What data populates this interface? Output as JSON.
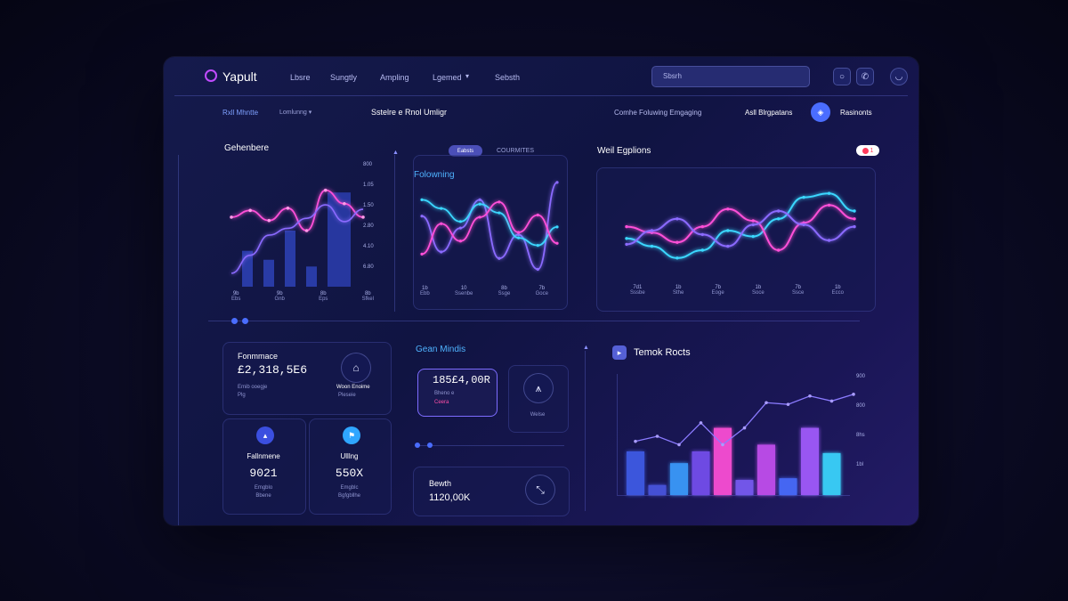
{
  "brand": {
    "name": "Yapult"
  },
  "nav": {
    "items": [
      "Lbsre",
      "Sungtly",
      "Ampling",
      "Lgemed"
    ],
    "dropdown_icon": "chevron-down-icon",
    "last_item": "Sebsth"
  },
  "header": {
    "search_placeholder": "Sbsrh",
    "icons": [
      "circle-icon",
      "phone-icon",
      "profile-icon"
    ]
  },
  "toolbar": {
    "left_link": "Rxll Mhntte",
    "filter": "Lomlunng",
    "center_title": "Sstelre e Rnol Umligr",
    "right_text": "Comhe Foluwing Emgaging",
    "right_link": "Asll Blrgpatans",
    "account_label": "Rasinonts"
  },
  "panel_left": {
    "title": "Gehenbere",
    "y_ticks": [
      "800",
      "1.05",
      "1.50",
      "2.80",
      "4.10",
      "6.80"
    ],
    "x_ticks": [
      "9b",
      "9b",
      "8b",
      "8b"
    ],
    "x_sublabels": [
      "Ebs",
      "Gnb",
      "Eps",
      "Sfkel"
    ]
  },
  "panel_mid": {
    "tab_active": "Eabsts",
    "tab_inactive": "COURMITES",
    "title": "Folowning",
    "x_ticks": [
      "1b",
      "10",
      "8b",
      "7b"
    ],
    "x_sublabels": [
      "Ebb",
      "Ssenbe",
      "Ssge",
      "Goce"
    ]
  },
  "panel_right": {
    "title": "Weil Egplions",
    "badge": "1",
    "x_ticks": [
      "7d1",
      "1b",
      "7b",
      "1b",
      "7b",
      "1b"
    ],
    "x_sublabels": [
      "Sssbe",
      "Sthe",
      "Eoge",
      "Soce",
      "Ssce",
      "Ecco"
    ]
  },
  "stats": {
    "card1": {
      "label": "Fonmmace",
      "value": "£2,318,5E6",
      "sub1": "Emib ooegje",
      "sub2": "Plg",
      "icon_label": "Woon Enoime",
      "icon_sub": "Pleseie"
    },
    "card2": {
      "label": "Fallnmene",
      "value": "9021",
      "sub1": "Emgblo",
      "sub2": "Bbene"
    },
    "card3": {
      "label": "Ulllng",
      "value": "550X",
      "sub1": "Emgblc",
      "sub2": "Bgfgbllhe"
    }
  },
  "metrics": {
    "title": "Gean Mindis",
    "card1": {
      "value": "185£4,00R",
      "sub1": "Bheno e",
      "sub2": "Ceera"
    },
    "card2": {
      "label": "Welse"
    },
    "card3": {
      "label": "Bewth",
      "value": "1120,00K"
    }
  },
  "panel_bar": {
    "title": "Temok Rocts",
    "y_ticks": [
      "900",
      "800",
      "8hs",
      "1bl"
    ]
  },
  "colors": {
    "pink": "#ff4fd8",
    "cyan": "#3ad7ff",
    "purple": "#8b6bff",
    "blue": "#4a6dff"
  },
  "chart_data": [
    {
      "type": "bar",
      "title": "Gehenbere",
      "values": [
        3.2,
        2.4,
        5.0,
        1.8,
        8.4
      ],
      "series_line_pink": [
        6.2,
        6.8,
        5.9,
        7.0,
        5.0,
        8.6,
        7.4,
        6.2
      ],
      "series_line_purple": [
        1.2,
        2.8,
        4.6,
        5.2,
        6.1,
        7.3,
        5.8,
        6.9
      ]
    },
    {
      "type": "line",
      "title": "Folowning",
      "series": [
        {
          "values": [
            6.5,
            3.2,
            5.4,
            8.0,
            2.6,
            4.8,
            1.6,
            9.6
          ]
        },
        {
          "values": [
            8.0,
            7.2,
            6.0,
            7.6,
            6.8,
            4.5,
            3.8,
            5.5
          ]
        },
        {
          "values": [
            3.0,
            5.8,
            4.2,
            6.4,
            7.8,
            5.0,
            6.6,
            4.0
          ]
        }
      ]
    },
    {
      "type": "line",
      "title": "Weil Egplions",
      "series": [
        {
          "values": [
            4.2,
            3.4,
            2.2,
            3.0,
            5.0,
            4.4,
            6.2,
            8.4,
            8.8,
            7.0
          ]
        },
        {
          "values": [
            5.4,
            4.8,
            3.8,
            5.4,
            7.2,
            6.0,
            3.0,
            5.8,
            7.6,
            6.2
          ]
        },
        {
          "values": [
            3.6,
            5.0,
            6.2,
            4.6,
            3.4,
            5.6,
            7.0,
            5.6,
            4.0,
            5.4
          ]
        }
      ]
    },
    {
      "type": "bar",
      "title": "Temok Rocts",
      "values": [
        5.2,
        1.2,
        3.8,
        5.2,
        8.0,
        1.8,
        6.0,
        2.0,
        8.0,
        5.0
      ],
      "colors": [
        "#3f5ce8",
        "#4a55e0",
        "#3a9dff",
        "#7650f0",
        "#ff4fd8",
        "#7a5cf5",
        "#c54ff0",
        "#4a6dff",
        "#a45cff",
        "#3ad7ff"
      ],
      "line": [
        6.4,
        7.0,
        6.0,
        8.6,
        6.0,
        8.0,
        11.0,
        10.8,
        11.8,
        11.2,
        12.0
      ]
    }
  ]
}
